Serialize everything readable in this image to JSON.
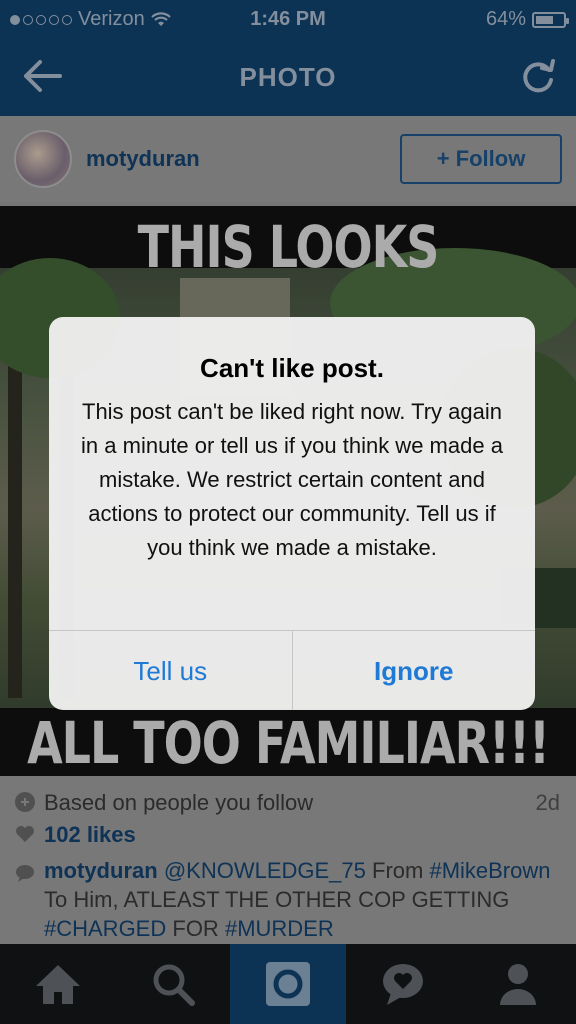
{
  "status_bar": {
    "carrier": "Verizon",
    "time": "1:46 PM",
    "battery_percent": "64%",
    "battery_level": 0.64,
    "signal_bars_filled": 1
  },
  "nav": {
    "title": "PHOTO",
    "back_icon": "back-arrow-icon",
    "refresh_icon": "refresh-icon"
  },
  "post": {
    "username": "motyduran",
    "follow_label": "+ Follow",
    "image_caption_top": "THIS LOOKS",
    "image_caption_bottom": "ALL TOO FAMILIAR!!!",
    "based_on": "Based on people you follow",
    "age": "2d",
    "likes": "102 likes",
    "caption_user": "motyduran",
    "caption_mention": "@KNOWLEDGE_75",
    "caption_text_1": "From",
    "caption_tag_1": "#MikeBrown",
    "caption_text_2": "To Him, ATLEAST THE OTHER COP GETTING",
    "caption_tag_2": "#CHARGED",
    "caption_text_3": "FOR",
    "caption_tag_3": "#MURDER"
  },
  "alert": {
    "title": "Can't like post.",
    "message": "This post can't be liked right now. Try again in a minute or tell us if you think we made a mistake. We restrict certain content and actions to protect our community. Tell us if you think we made a mistake.",
    "button_left": "Tell us",
    "button_right": "Ignore"
  },
  "tabs": [
    {
      "icon": "home-icon"
    },
    {
      "icon": "search-icon"
    },
    {
      "icon": "camera-icon",
      "active": true
    },
    {
      "icon": "activity-icon"
    },
    {
      "icon": "profile-icon"
    }
  ],
  "colors": {
    "nav_bg": "#0f3b63",
    "link": "#123d66",
    "alert_button": "#1f7ad6"
  }
}
